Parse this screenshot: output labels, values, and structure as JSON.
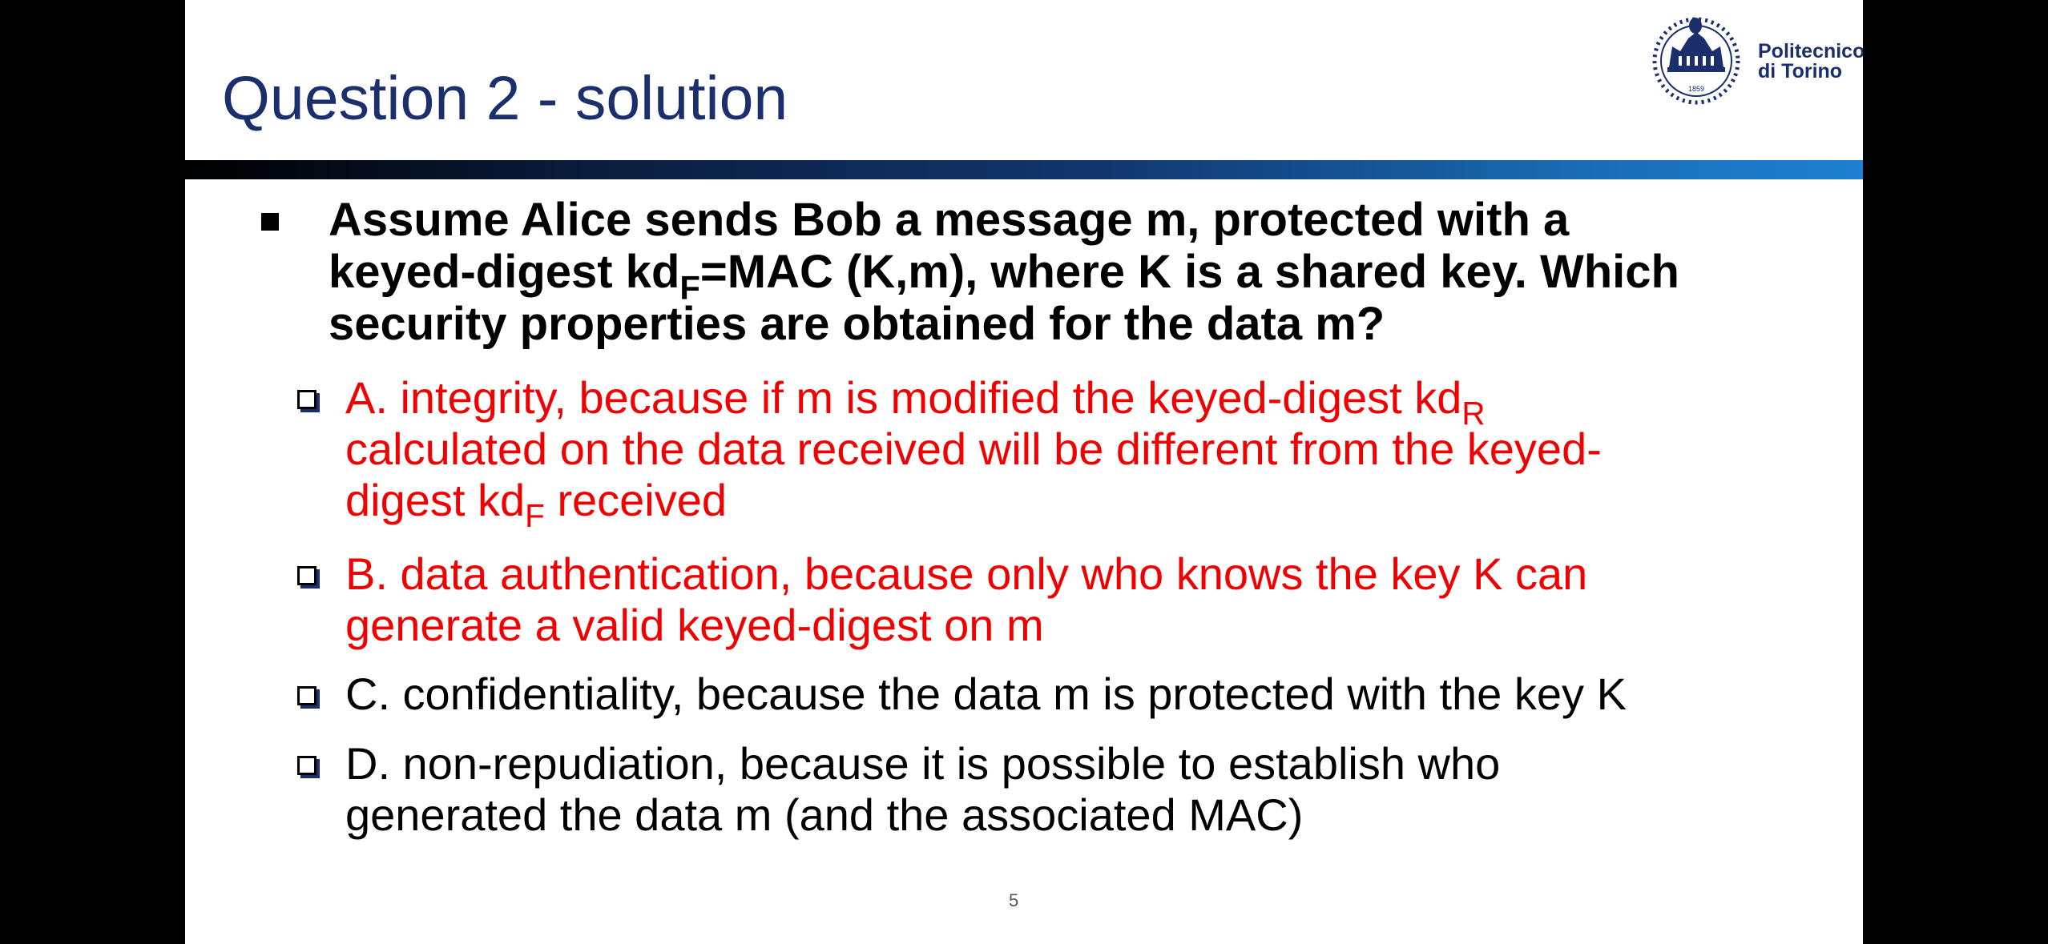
{
  "slide": {
    "title": "Question 2 - solution",
    "logo": {
      "text_line1": "Politecnico",
      "text_line2": "di Torino",
      "year": "1859"
    },
    "question": {
      "lines": [
        "Assume Alice sends Bob a message m, protected with a",
        {
          "before": "keyed-digest kd",
          "sub": "F",
          "after": "=MAC (K,m), where K is a shared key. Which"
        },
        "security properties are obtained for the data m?"
      ]
    },
    "options": [
      {
        "color": "#f00000",
        "lines": [
          {
            "before": "A. integrity, because if m is modified the keyed-digest kd",
            "sub": "R",
            "after": ""
          },
          "calculated on the data received will be different from the keyed-",
          {
            "before": "digest kd",
            "sub": "F",
            "after": " received"
          }
        ]
      },
      {
        "color": "#f00000",
        "lines": [
          "B. data authentication, because only who knows the key K can",
          "generate a valid keyed-digest on m"
        ]
      },
      {
        "color": "#000000",
        "lines": [
          "C. confidentiality, because the data m is protected with the key K"
        ]
      },
      {
        "color": "#000000",
        "lines": [
          "D. non-repudiation, because it is possible to establish who",
          "generated the data m (and the associated MAC)"
        ]
      }
    ],
    "page_number": "5"
  },
  "colors": {
    "title": "#1a2f6b",
    "correct": "#f00000",
    "text": "#000000",
    "background": "#000000"
  }
}
